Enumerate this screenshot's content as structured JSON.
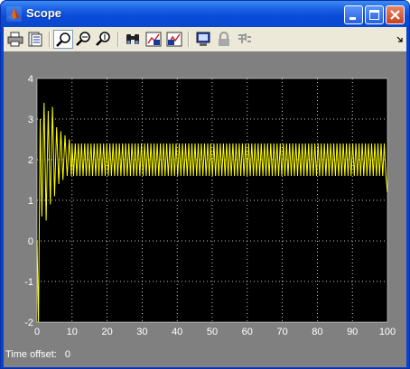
{
  "window": {
    "title": "Scope"
  },
  "toolbar": {
    "buttons": [
      {
        "name": "print-icon",
        "tooltip": ""
      },
      {
        "name": "parameters-icon"
      },
      {
        "name": "zoom-icon",
        "active": true
      },
      {
        "name": "zoom-x-icon"
      },
      {
        "name": "zoom-y-icon"
      },
      {
        "name": "autoscale-icon"
      },
      {
        "name": "save-axes-icon"
      },
      {
        "name": "restore-axes-icon"
      },
      {
        "name": "floating-scope-icon"
      },
      {
        "name": "lock-axes-icon"
      },
      {
        "name": "signal-selector-icon"
      }
    ]
  },
  "status": {
    "label": "Time offset:",
    "value": "0"
  },
  "colors": {
    "plot_background": "#000000",
    "trace": "#ffff00",
    "frame": "#808080",
    "grid": "#ffffff"
  },
  "chart_data": {
    "type": "line",
    "xlim": [
      0,
      100
    ],
    "ylim": [
      -2,
      4
    ],
    "x_ticks": [
      "0",
      "10",
      "20",
      "30",
      "40",
      "50",
      "60",
      "70",
      "80",
      "90",
      "100"
    ],
    "y_ticks": [
      "-2",
      "-1",
      "0",
      "1",
      "2",
      "3",
      "4"
    ],
    "grid": true,
    "series": [
      {
        "transient": [
          [
            0,
            0
          ],
          [
            0.4,
            -2.0
          ],
          [
            0.9,
            3.0
          ],
          [
            1.4,
            0.6
          ],
          [
            2.0,
            3.4
          ],
          [
            2.6,
            0.5
          ],
          [
            3.2,
            3.2
          ],
          [
            3.8,
            0.9
          ],
          [
            4.4,
            3.3
          ],
          [
            5.0,
            1.1
          ],
          [
            5.6,
            2.8
          ],
          [
            6.2,
            1.4
          ],
          [
            6.8,
            2.7
          ],
          [
            7.4,
            1.5
          ],
          [
            8.0,
            2.6
          ],
          [
            8.6,
            1.6
          ],
          [
            9.2,
            2.5
          ],
          [
            9.8,
            1.6
          ]
        ],
        "steady_state": {
          "from": 10,
          "to": 100,
          "min": 1.6,
          "max": 2.4,
          "period": 0.9
        },
        "end_value": 1.2
      }
    ]
  }
}
